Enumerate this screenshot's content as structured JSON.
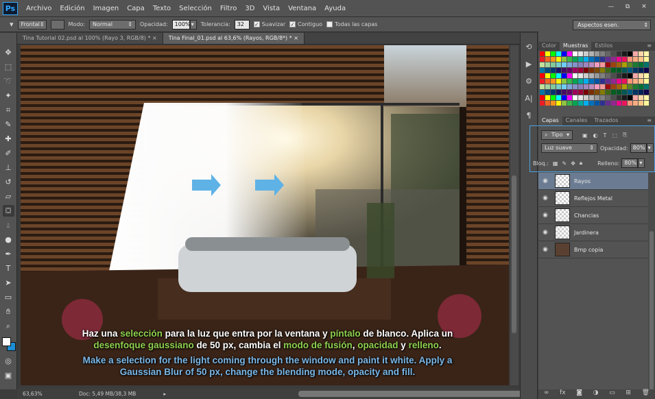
{
  "app": {
    "logo": "Ps"
  },
  "menu": [
    "Archivo",
    "Edición",
    "Imagen",
    "Capa",
    "Texto",
    "Selección",
    "Filtro",
    "3D",
    "Vista",
    "Ventana",
    "Ayuda"
  ],
  "window_buttons": [
    "—",
    "⧉",
    "✕"
  ],
  "options": {
    "fill_source": "Frontal",
    "mode_label": "Modo:",
    "mode_value": "Normal",
    "opacity_label": "Opacidad:",
    "opacity_value": "100%",
    "tolerance_label": "Tolerancia:",
    "tolerance_value": "32",
    "smooth_label": "Suavizar",
    "contiguous_label": "Contiguo",
    "all_layers_label": "Todas las capas",
    "workspace": "Aspectos esen."
  },
  "tabs": [
    {
      "label": "Tina Tutorial 02.psd al 100% (Rayo 3, RGB/8) *",
      "active": false
    },
    {
      "label": "Tina Final_01.psd al 63,6% (Rayos, RGB/8*) *",
      "active": true
    }
  ],
  "status": {
    "zoom": "63,63%",
    "doc": "Doc: 5,49 MB/38,3 MB"
  },
  "color_panel": {
    "tabs": [
      "Color",
      "Muestras",
      "Estilos"
    ],
    "active": "Muestras"
  },
  "layers_panel": {
    "tabs": [
      "Capas",
      "Canales",
      "Trazados"
    ],
    "active": "Capas",
    "filter": "Tipo",
    "blend_mode": "Luz suave",
    "opacity_label": "Opacidad:",
    "opacity_value": "80%",
    "lock_label": "Bloq.:",
    "fill_label": "Relleno:",
    "fill_value": "80%",
    "layers": [
      {
        "name": "Rayos",
        "active": true
      },
      {
        "name": "Reflejos Metal",
        "active": false
      },
      {
        "name": "Chancias",
        "active": false
      },
      {
        "name": "Jardinera",
        "active": false
      },
      {
        "name": "Bmp copia",
        "active": false
      }
    ]
  },
  "subtitles": {
    "es_1": "Haz una ",
    "es_2": "selección",
    "es_3": " para la luz que entra por la ventana y ",
    "es_4": "píntalo",
    "es_5": " de blanco. Aplica un ",
    "es_6": "desenfoque gaussiano",
    "es_7": " de 50 px, cambia el ",
    "es_8": "modo de fusión",
    "es_9": ", ",
    "es_10": "opacidad",
    "es_11": " y ",
    "es_12": "relleno",
    "es_13": ".",
    "en": "Make a selection for the light coming through the window and paint it white. Apply a Gaussian Blur of 50 px, change the blending mode, opacity and fill."
  },
  "colors": {
    "accent": "#4aa3df",
    "subtitle_highlight": "#8fd14f",
    "subtitle_english": "#7ab8e8",
    "arrow": "#5fb2e6"
  },
  "tools": [
    "move-icon",
    "marquee-icon",
    "lasso-icon",
    "magic-wand-icon",
    "crop-icon",
    "eyedropper-icon",
    "healing-icon",
    "brush-icon",
    "stamp-icon",
    "history-brush-icon",
    "eraser-icon",
    "paint-bucket-icon",
    "blur-icon",
    "dodge-icon",
    "pen-icon",
    "type-icon",
    "path-select-icon",
    "shape-icon",
    "hand-icon",
    "zoom-icon"
  ]
}
